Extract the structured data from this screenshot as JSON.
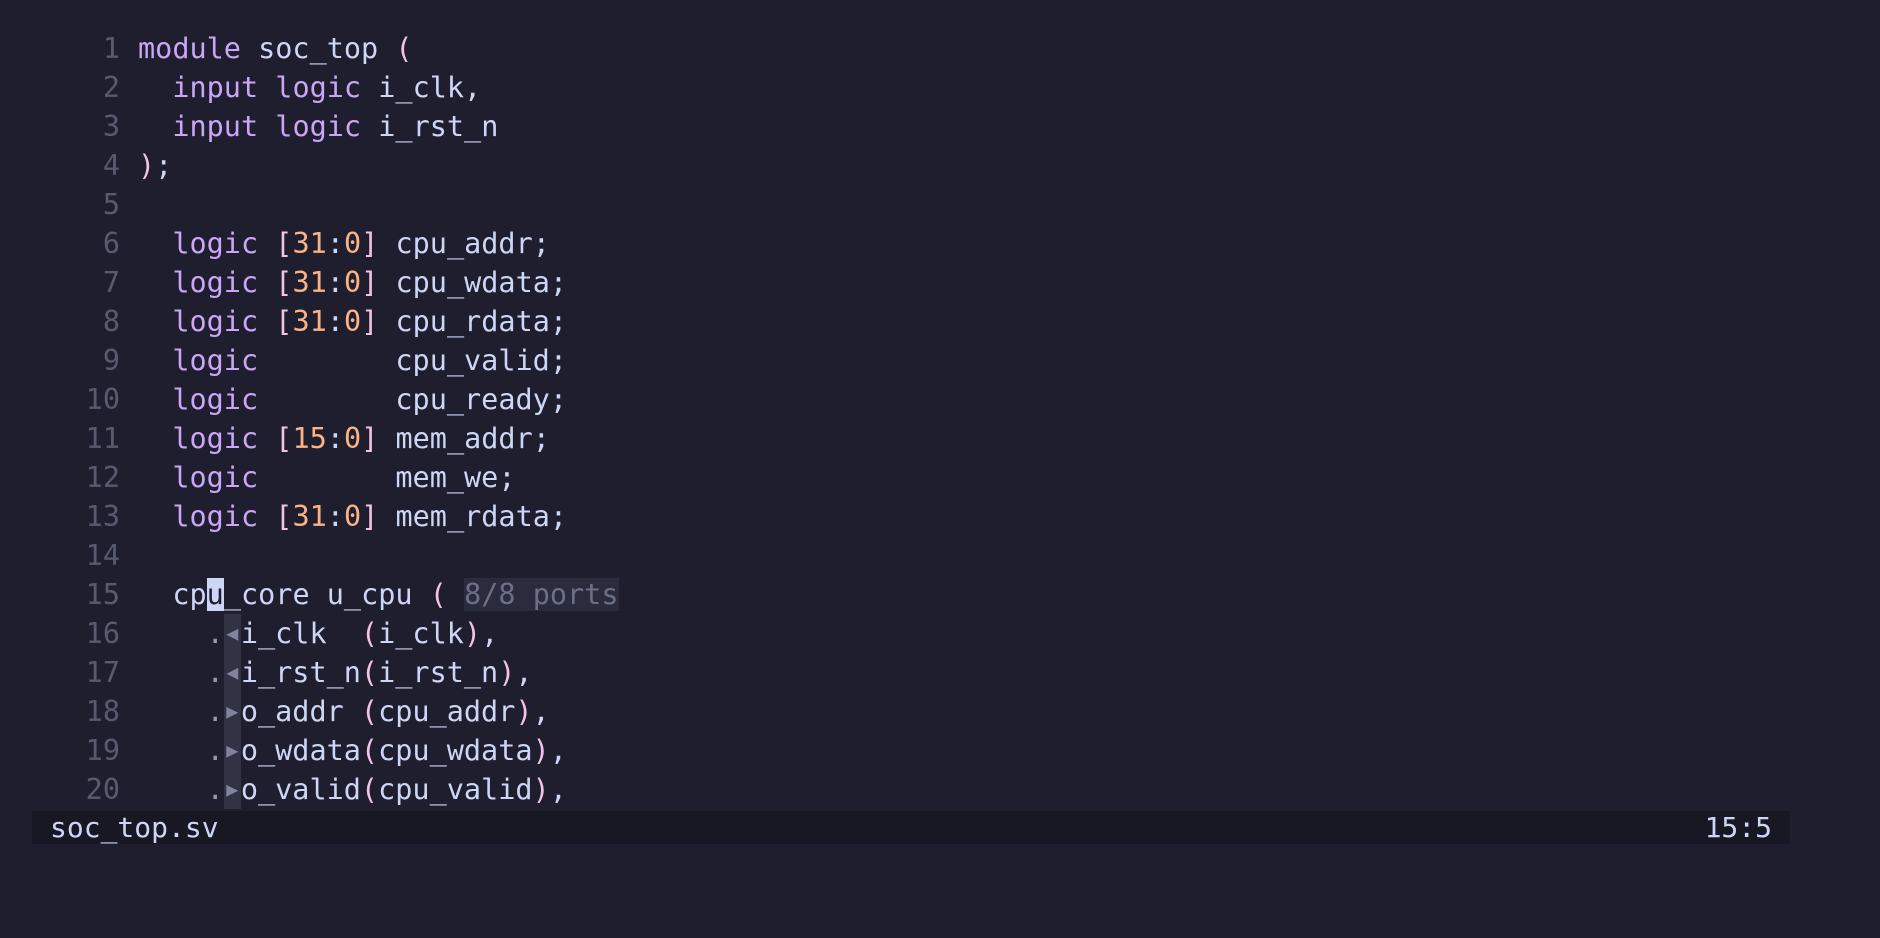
{
  "editor": {
    "lines": [
      {
        "n": "1",
        "tokens": [
          {
            "t": "module",
            "c": "kw"
          },
          {
            "t": " soc_top ",
            "c": "id"
          },
          {
            "t": "(",
            "c": "punc"
          }
        ]
      },
      {
        "n": "2",
        "tokens": [
          {
            "t": "  "
          },
          {
            "t": "input",
            "c": "kw"
          },
          {
            "t": " "
          },
          {
            "t": "logic",
            "c": "kw"
          },
          {
            "t": " i_clk",
            "c": "id"
          },
          {
            "t": ",",
            "c": "id"
          }
        ]
      },
      {
        "n": "3",
        "tokens": [
          {
            "t": "  "
          },
          {
            "t": "input",
            "c": "kw"
          },
          {
            "t": " "
          },
          {
            "t": "logic",
            "c": "kw"
          },
          {
            "t": " i_rst_n",
            "c": "id"
          }
        ]
      },
      {
        "n": "4",
        "tokens": [
          {
            "t": ")",
            "c": "punc"
          },
          {
            "t": ";",
            "c": "id"
          }
        ]
      },
      {
        "n": "5",
        "tokens": []
      },
      {
        "n": "6",
        "tokens": [
          {
            "t": "  "
          },
          {
            "t": "logic",
            "c": "kw"
          },
          {
            "t": " "
          },
          {
            "t": "[",
            "c": "punc"
          },
          {
            "t": "31",
            "c": "num"
          },
          {
            "t": ":",
            "c": "id"
          },
          {
            "t": "0",
            "c": "num"
          },
          {
            "t": "]",
            "c": "punc"
          },
          {
            "t": " cpu_addr;",
            "c": "id"
          }
        ]
      },
      {
        "n": "7",
        "tokens": [
          {
            "t": "  "
          },
          {
            "t": "logic",
            "c": "kw"
          },
          {
            "t": " "
          },
          {
            "t": "[",
            "c": "punc"
          },
          {
            "t": "31",
            "c": "num"
          },
          {
            "t": ":",
            "c": "id"
          },
          {
            "t": "0",
            "c": "num"
          },
          {
            "t": "]",
            "c": "punc"
          },
          {
            "t": " cpu_wdata;",
            "c": "id"
          }
        ]
      },
      {
        "n": "8",
        "tokens": [
          {
            "t": "  "
          },
          {
            "t": "logic",
            "c": "kw"
          },
          {
            "t": " "
          },
          {
            "t": "[",
            "c": "punc"
          },
          {
            "t": "31",
            "c": "num"
          },
          {
            "t": ":",
            "c": "id"
          },
          {
            "t": "0",
            "c": "num"
          },
          {
            "t": "]",
            "c": "punc"
          },
          {
            "t": " cpu_rdata;",
            "c": "id"
          }
        ]
      },
      {
        "n": "9",
        "tokens": [
          {
            "t": "  "
          },
          {
            "t": "logic",
            "c": "kw"
          },
          {
            "t": "        cpu_valid;",
            "c": "id"
          }
        ]
      },
      {
        "n": "10",
        "tokens": [
          {
            "t": "  "
          },
          {
            "t": "logic",
            "c": "kw"
          },
          {
            "t": "        cpu_ready;",
            "c": "id"
          }
        ]
      },
      {
        "n": "11",
        "tokens": [
          {
            "t": "  "
          },
          {
            "t": "logic",
            "c": "kw"
          },
          {
            "t": " "
          },
          {
            "t": "[",
            "c": "punc"
          },
          {
            "t": "15",
            "c": "num"
          },
          {
            "t": ":",
            "c": "id"
          },
          {
            "t": "0",
            "c": "num"
          },
          {
            "t": "]",
            "c": "punc"
          },
          {
            "t": " mem_addr;",
            "c": "id"
          }
        ]
      },
      {
        "n": "12",
        "tokens": [
          {
            "t": "  "
          },
          {
            "t": "logic",
            "c": "kw"
          },
          {
            "t": "        mem_we;",
            "c": "id"
          }
        ]
      },
      {
        "n": "13",
        "tokens": [
          {
            "t": "  "
          },
          {
            "t": "logic",
            "c": "kw"
          },
          {
            "t": " "
          },
          {
            "t": "[",
            "c": "punc"
          },
          {
            "t": "31",
            "c": "num"
          },
          {
            "t": ":",
            "c": "id"
          },
          {
            "t": "0",
            "c": "num"
          },
          {
            "t": "]",
            "c": "punc"
          },
          {
            "t": " mem_rdata;",
            "c": "id"
          }
        ]
      },
      {
        "n": "14",
        "tokens": []
      },
      {
        "n": "15",
        "tokens": [
          {
            "t": "  cp",
            "c": "id"
          },
          {
            "t": "u",
            "c": "cursor"
          },
          {
            "t": "_core u_cpu ",
            "c": "id"
          },
          {
            "t": "(",
            "c": "punc"
          },
          {
            "t": " "
          },
          {
            "t": "8/8 ports",
            "c": "hint"
          }
        ]
      },
      {
        "n": "16",
        "tokens": [
          {
            "t": "    "
          },
          {
            "t": ".",
            "c": "dot"
          },
          {
            "t": "◀",
            "c": "dir"
          },
          {
            "t": "i_clk  ",
            "c": "id"
          },
          {
            "t": "(",
            "c": "punc"
          },
          {
            "t": "i_clk",
            "c": "id"
          },
          {
            "t": ")",
            "c": "punc"
          },
          {
            "t": ",",
            "c": "id"
          }
        ]
      },
      {
        "n": "17",
        "tokens": [
          {
            "t": "    "
          },
          {
            "t": ".",
            "c": "dot"
          },
          {
            "t": "◀",
            "c": "dir"
          },
          {
            "t": "i_rst_n",
            "c": "id"
          },
          {
            "t": "(",
            "c": "punc"
          },
          {
            "t": "i_rst_n",
            "c": "id"
          },
          {
            "t": ")",
            "c": "punc"
          },
          {
            "t": ",",
            "c": "id"
          }
        ]
      },
      {
        "n": "18",
        "tokens": [
          {
            "t": "    "
          },
          {
            "t": ".",
            "c": "dot"
          },
          {
            "t": "▶",
            "c": "dir"
          },
          {
            "t": "o_addr ",
            "c": "id"
          },
          {
            "t": "(",
            "c": "punc"
          },
          {
            "t": "cpu_addr",
            "c": "id"
          },
          {
            "t": ")",
            "c": "punc"
          },
          {
            "t": ",",
            "c": "id"
          }
        ]
      },
      {
        "n": "19",
        "tokens": [
          {
            "t": "    "
          },
          {
            "t": ".",
            "c": "dot"
          },
          {
            "t": "▶",
            "c": "dir"
          },
          {
            "t": "o_wdata",
            "c": "id"
          },
          {
            "t": "(",
            "c": "punc"
          },
          {
            "t": "cpu_wdata",
            "c": "id"
          },
          {
            "t": ")",
            "c": "punc"
          },
          {
            "t": ",",
            "c": "id"
          }
        ]
      },
      {
        "n": "20",
        "tokens": [
          {
            "t": "    "
          },
          {
            "t": ".",
            "c": "dot"
          },
          {
            "t": "▶",
            "c": "dir"
          },
          {
            "t": "o_valid",
            "c": "id"
          },
          {
            "t": "(",
            "c": "punc"
          },
          {
            "t": "cpu_valid",
            "c": "id"
          },
          {
            "t": ")",
            "c": "punc"
          },
          {
            "t": ",",
            "c": "id"
          }
        ]
      }
    ]
  },
  "statusbar": {
    "filename": "soc_top.sv",
    "position": "15:5"
  },
  "colors": {
    "background": "#1e1e2e",
    "keyword": "#cba6f7",
    "number": "#fab387",
    "punctuation": "#f5c2e7",
    "text": "#cdd6f4",
    "line_number": "#585b70",
    "statusbar_bg": "#181825"
  },
  "icons": {
    "input_port": "triangle-left-icon",
    "output_port": "triangle-right-icon"
  }
}
